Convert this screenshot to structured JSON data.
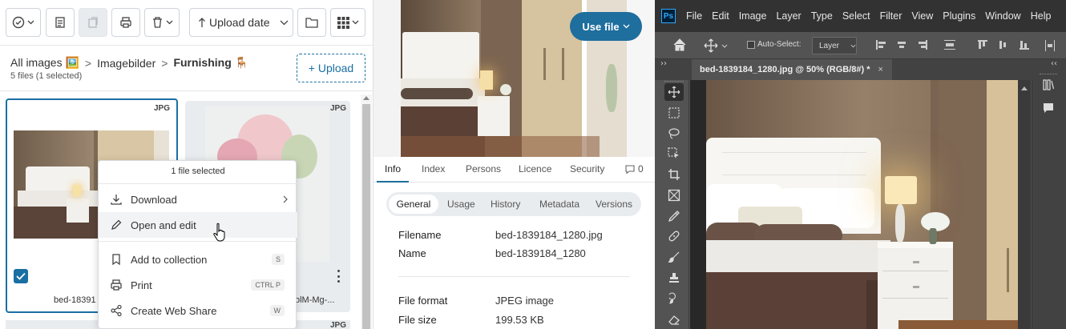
{
  "toolbar": {
    "upload_date": "Upload date",
    "upload_button": "+ Upload"
  },
  "breadcrumb": {
    "root": "All images 🖼️",
    "sep1": ">",
    "folder": "Imagebilder",
    "sep2": ">",
    "current": "Furnishing 🪑",
    "count": "5 files (1 selected)"
  },
  "grid": {
    "items": [
      {
        "badge": "JPG",
        "name": "bed-18391"
      },
      {
        "badge": "JPG",
        "name": "olM-Mg-..."
      },
      {
        "badge": "JPG",
        "name": ""
      }
    ]
  },
  "context_menu": {
    "header": "1 file selected",
    "items": [
      {
        "label": "Download",
        "shortcut": ""
      },
      {
        "label": "Open and edit",
        "shortcut": ""
      },
      {
        "label": "Add to collection",
        "shortcut": "S"
      },
      {
        "label": "Print",
        "shortcut": "CTRL P"
      },
      {
        "label": "Create Web Share",
        "shortcut": "W"
      }
    ]
  },
  "detail": {
    "use_file": "Use file",
    "tabs": [
      "Info",
      "Index",
      "Persons",
      "Licence",
      "Security"
    ],
    "comments": "0",
    "subtabs": [
      "General",
      "Usage",
      "History",
      "Metadata",
      "Versions"
    ],
    "fields": [
      {
        "label": "Filename",
        "value": "bed-1839184_1280.jpg"
      },
      {
        "label": "Name",
        "value": "bed-1839184_1280"
      },
      {
        "label": "File format",
        "value": "JPEG image"
      },
      {
        "label": "File size",
        "value": "199.53 KB"
      }
    ]
  },
  "photoshop": {
    "logo": "Ps",
    "menu": [
      "File",
      "Edit",
      "Image",
      "Layer",
      "Type",
      "Select",
      "Filter",
      "View",
      "Plugins",
      "Window",
      "Help"
    ],
    "auto_select": "Auto-Select:",
    "layer_select": "Layer",
    "doc_tab": "bed-1839184_1280.jpg @ 50% (RGB/8#) *",
    "close": "×"
  }
}
